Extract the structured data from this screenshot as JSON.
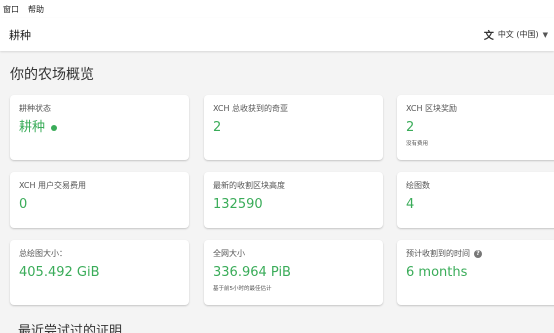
{
  "menu": {
    "window": "窗口",
    "help": "帮助"
  },
  "appbar": {
    "title": "耕种",
    "language": "中文 (中国)"
  },
  "page": {
    "title": "你的农场概览"
  },
  "cards": {
    "farming_status": {
      "label": "耕种状态",
      "value": "耕种",
      "status_color": "#3aac59"
    },
    "total_xch": {
      "label": "XCH 总收获到的奇亚",
      "value": "2"
    },
    "block_rewards": {
      "label": "XCH 区块奖励",
      "value": "2",
      "sub": "没有费用"
    },
    "user_fees": {
      "label": "XCH 用户交易费用",
      "value": "0"
    },
    "last_height": {
      "label": "最新的收割区块高度",
      "value": "132590"
    },
    "plot_count": {
      "label": "绘图数",
      "value": "4"
    },
    "total_size": {
      "label": "总绘图大小：",
      "value": "405.492 GiB"
    },
    "network_space": {
      "label": "全网大小",
      "value": "336.964 PiB",
      "sub": "基于前5小时的最佳估计"
    },
    "expected_time": {
      "label": "预计收割到的时间",
      "value": "6 months"
    }
  },
  "section": {
    "title": "最近尝试过的证明"
  },
  "colors": {
    "accent": "#3aac59"
  },
  "icons": {
    "translate": "translate-icon",
    "caret": "chevron-down-icon",
    "help": "help-icon"
  }
}
